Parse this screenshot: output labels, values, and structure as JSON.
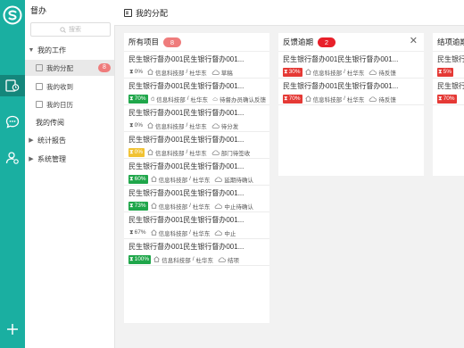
{
  "sidebar": {
    "title": "督办",
    "search_placeholder": "搜索",
    "nav": {
      "my_work": "我的工作",
      "my_assigned": "我的分配",
      "my_assigned_count": "8",
      "my_received": "我的收到",
      "my_calendar": "我的日历",
      "my_circulation": "我的传阅",
      "statistics": "统计报告",
      "system": "系统管理"
    }
  },
  "header": {
    "title": "我的分配"
  },
  "columns": {
    "all": {
      "title": "所有项目",
      "count": "8",
      "cards": [
        {
          "title": "民生银行督办001民生银行督办001...",
          "pct": "0%",
          "dept": "信息科技部",
          "person": "杜华东",
          "status": "草稿"
        },
        {
          "title": "民生银行督办001民生银行督办001...",
          "pct": "70%",
          "dept": "信息科技部",
          "person": "杜华东",
          "status": "待督办员确认反馈"
        },
        {
          "title": "民生银行督办001民生银行督办001...",
          "pct": "0%",
          "dept": "信息科技部",
          "person": "杜华东",
          "status": "待分发"
        },
        {
          "title": "民生银行督办001民生银行督办001...",
          "pct": "0%",
          "dept": "信息科技部",
          "person": "杜华东",
          "status": "部门待签收"
        },
        {
          "title": "民生银行督办001民生银行督办001...",
          "pct": "60%",
          "dept": "信息科技部",
          "person": "杜华东",
          "status": "延期待确认"
        },
        {
          "title": "民生银行督办001民生银行督办001...",
          "pct": "73%",
          "dept": "信息科技部",
          "person": "杜华东",
          "status": "中止待确认"
        },
        {
          "title": "民生银行督办001民生银行督办001...",
          "pct": "67%",
          "dept": "信息科技部",
          "person": "杜华东",
          "status": "中止"
        },
        {
          "title": "民生银行督办001民生银行督办001...",
          "pct": "100%",
          "dept": "信息科技部",
          "person": "杜华东",
          "status": "结项"
        }
      ]
    },
    "overdue": {
      "title": "反馈逾期",
      "count": "2",
      "cards": [
        {
          "title": "民生银行督办001民生银行督办001...",
          "pct": "30%",
          "dept": "信息科技部",
          "person": "杜华东",
          "status": "待反馈"
        },
        {
          "title": "民生银行督办001民生银行督办001...",
          "pct": "70%",
          "dept": "信息科技部",
          "person": "杜华东",
          "status": "待反馈"
        }
      ]
    },
    "closing": {
      "title": "结项逾期",
      "cards": [
        {
          "title": "民生银行",
          "pct": "5%"
        },
        {
          "title": "民生银行",
          "pct": "70%"
        }
      ]
    }
  },
  "colors": {
    "accent": "#1aafa1",
    "green": "#1fa64a",
    "yellow": "#f1c232",
    "red": "#e53935"
  }
}
